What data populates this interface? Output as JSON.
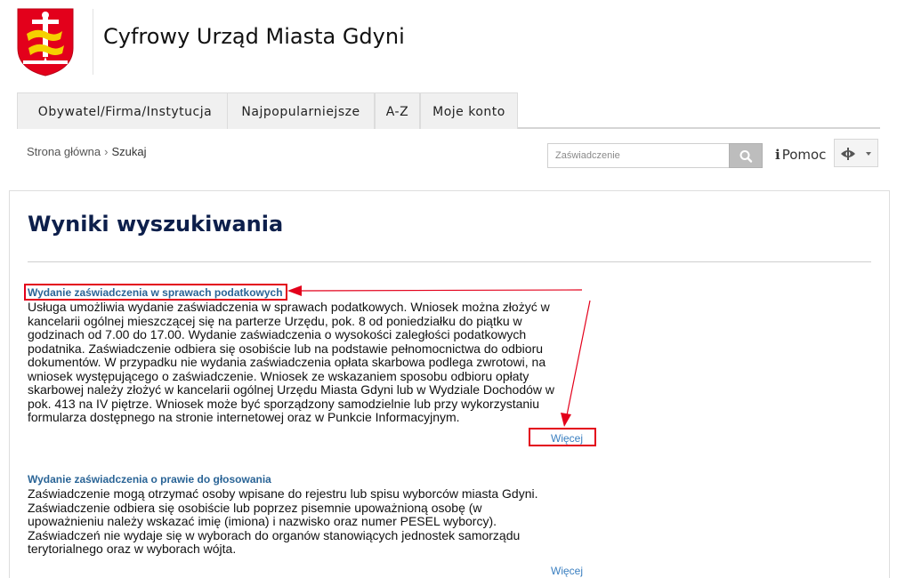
{
  "header": {
    "site_title": "Cyfrowy Urząd Miasta Gdyni",
    "logo_icon": "gdynia-coat-of-arms-icon"
  },
  "nav": {
    "items": [
      {
        "label": "Obywatel/Firma/Instytucja"
      },
      {
        "label": "Najpopularniejsze"
      },
      {
        "label": "A-Z"
      },
      {
        "label": "Moje konto"
      }
    ]
  },
  "breadcrumb": {
    "home": "Strona główna",
    "separator": "›",
    "current": "Szukaj"
  },
  "search": {
    "placeholder": "Zaświadczenie",
    "icon": "search-icon"
  },
  "help": {
    "label": "Pomoc",
    "icon": "info-icon"
  },
  "accessibility": {
    "icon": "eye-icon"
  },
  "main": {
    "title": "Wyniki wyszukiwania",
    "results": [
      {
        "title": "Wydanie zaświadczenia w sprawach podatkowych",
        "lines": [
          "Usługa umożliwia wydanie zaświadczenia w sprawach podatkowych. Wniosek można złożyć w",
          "kancelarii ogólnej mieszczącej się na parterze Urzędu, pok. 8 od poniedziałku do piątku w",
          "godzinach od 7.00 do 17.00. Wydanie zaświadczenia o wysokości zaległości podatkowych",
          "podatnika. Zaświadczenie odbiera się osobiście lub na podstawie pełnomocnictwa do odbioru",
          "dokumentów. W przypadku nie wydania zaświadczenia opłata skarbowa podlega zwrotowi, na",
          "wniosek występującego o zaświadczenie. Wniosek ze wskazaniem sposobu odbioru opłaty",
          "skarbowej należy złożyć w kancelarii ogólnej Urzędu Miasta Gdyni lub w Wydziale Dochodów w",
          "pok. 413 na IV piętrze. Wniosek może być sporządzony samodzielnie lub przy wykorzystaniu",
          "formularza dostępnego na stronie internetowej oraz w Punkcie Informacyjnym."
        ],
        "more": "Więcej"
      },
      {
        "title": "Wydanie zaświadczenia o prawie do głosowania",
        "lines": [
          "Zaświadczenie mogą otrzymać osoby wpisane do rejestru lub spisu wyborców miasta Gdyni.",
          "Zaświadczenie odbiera się osobiście lub poprzez pisemnie upoważnioną osobę (w",
          "upoważnieniu należy wskazać imię (imiona) i nazwisko oraz numer PESEL wyborcy).",
          "Zaświadczeń nie wydaje się w wyborach do organów stanowiących jednostek samorządu",
          "terytorialnego oraz w wyborach wójta."
        ],
        "more": "Więcej"
      }
    ]
  },
  "colors": {
    "page_title": "#0d1f4b",
    "result_link": "#2a6496",
    "more_link": "#3a7fc0",
    "annotation": "#e3001b",
    "logo_red": "#e3001b",
    "logo_yellow": "#f5d000"
  }
}
